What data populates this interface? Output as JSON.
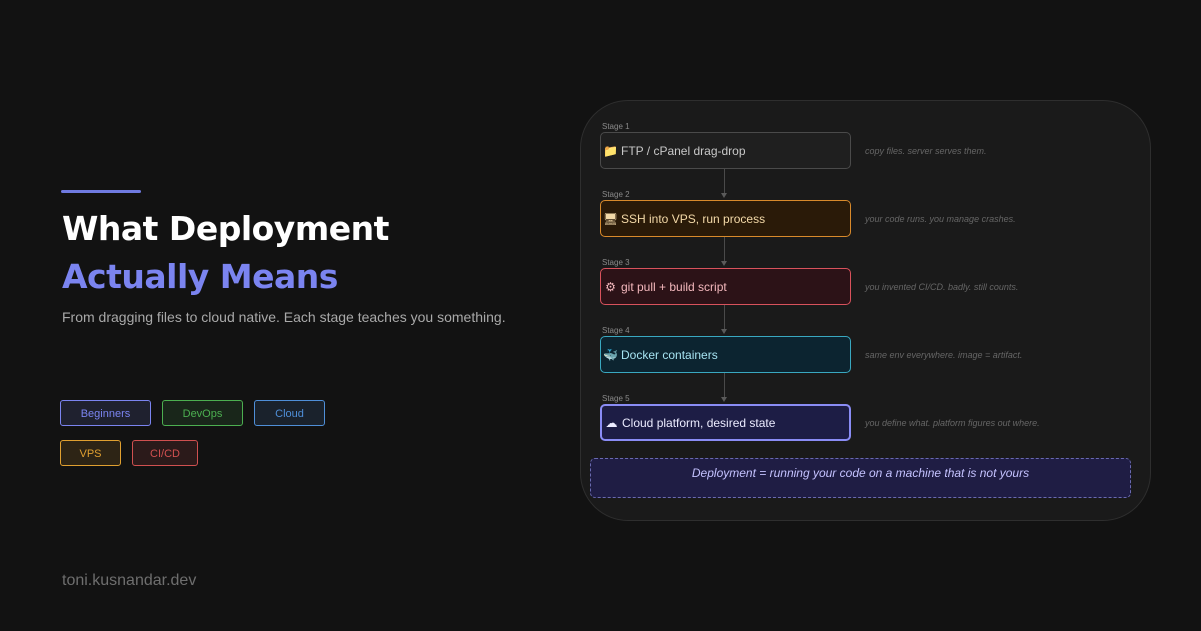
{
  "title": {
    "line1": "What Deployment",
    "line2": "Actually Means"
  },
  "subtitle": "From dragging files to cloud native. Each stage teaches you something.",
  "tags": [
    {
      "label": "Beginners",
      "color": "#7b84f0"
    },
    {
      "label": "DevOps",
      "color": "#4caf50"
    },
    {
      "label": "Cloud",
      "color": "#4f8fd8"
    },
    {
      "label": "VPS",
      "color": "#e0a030"
    },
    {
      "label": "CI/CD",
      "color": "#d05050"
    }
  ],
  "footer": "toni.kusnandar.dev",
  "stages": [
    {
      "label": "Stage 1",
      "icon": "folder-icon",
      "glyph": "📁",
      "text": "FTP / cPanel drag-drop",
      "note": "copy files. server serves them.",
      "border": "#4a4a4a",
      "bg": "#1f1f1f",
      "color": "#c8c8c8"
    },
    {
      "label": "Stage 2",
      "icon": "monitor-icon",
      "glyph": "🖥",
      "text": "SSH into VPS, run process",
      "note": "your code runs. you manage crashes.",
      "border": "#d98a2b",
      "bg": "#2a1a08",
      "color": "#f3d9a8"
    },
    {
      "label": "Stage 3",
      "icon": "gear-icon",
      "glyph": "⚙",
      "text": "git pull + build script",
      "note": "you invented CI/CD. badly. still counts.",
      "border": "#d8525c",
      "bg": "#2c1217",
      "color": "#f4b8bd"
    },
    {
      "label": "Stage 4",
      "icon": "whale-icon",
      "glyph": "🐳",
      "text": "Docker containers",
      "note": "same env everywhere. image = artifact.",
      "border": "#39a8c0",
      "bg": "#0c2430",
      "color": "#a6e3f1"
    },
    {
      "label": "Stage 5",
      "icon": "cloud-icon",
      "glyph": "☁",
      "text": "Cloud platform, desired state",
      "note": "you define what. platform figures out where.",
      "border": "#8a8cf5",
      "bg": "#1d1d45",
      "color": "#ececff"
    }
  ],
  "summary": "Deployment = running your code on a machine that is not yours"
}
